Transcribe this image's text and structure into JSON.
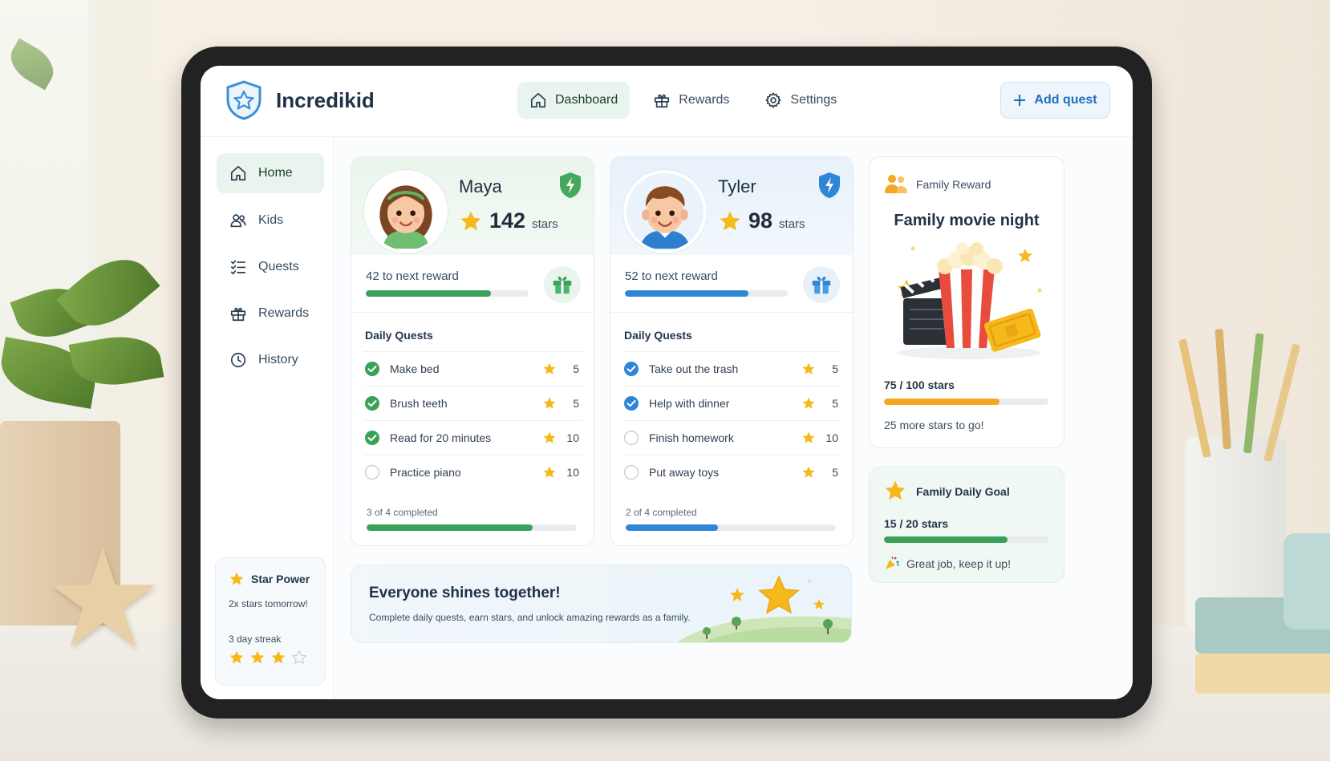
{
  "app": {
    "name": "Incredikid",
    "header_nav": [
      {
        "label": "Dashboard",
        "icon": "home-icon",
        "active": true
      },
      {
        "label": "Rewards",
        "icon": "gift-icon",
        "active": false
      },
      {
        "label": "Settings",
        "icon": "gear-icon",
        "active": false
      }
    ],
    "add_quest_label": "Add quest"
  },
  "sidebar": {
    "items": [
      {
        "label": "Home",
        "icon": "home-icon",
        "active": true
      },
      {
        "label": "Kids",
        "icon": "users-icon",
        "active": false
      },
      {
        "label": "Quests",
        "icon": "checklist-icon",
        "active": false
      },
      {
        "label": "Rewards",
        "icon": "gift-icon",
        "active": false
      },
      {
        "label": "History",
        "icon": "clock-icon",
        "active": false
      }
    ],
    "star_power": {
      "title": "Star Power",
      "subtitle": "2x stars tomorrow!",
      "streak_label": "3 day streak",
      "streak_filled": 3,
      "streak_total": 4
    }
  },
  "kids": [
    {
      "name": "Maya",
      "stars": "142",
      "stars_label": "stars",
      "next_reward": "42 to next reward",
      "reward_progress": 0.77,
      "accent": "#3aa15a",
      "daily_quests_title": "Daily Quests",
      "quests": [
        {
          "name": "Make bed",
          "stars": "5",
          "done": true
        },
        {
          "name": "Brush teeth",
          "stars": "5",
          "done": true
        },
        {
          "name": "Read for 20 minutes",
          "stars": "10",
          "done": true
        },
        {
          "name": "Practice piano",
          "stars": "10",
          "done": false
        }
      ],
      "completed_label": "3 of 4 completed",
      "completed_progress": 0.79
    },
    {
      "name": "Tyler",
      "stars": "98",
      "stars_label": "stars",
      "next_reward": "52 to next reward",
      "reward_progress": 0.76,
      "accent": "#2f86d6",
      "daily_quests_title": "Daily Quests",
      "quests": [
        {
          "name": "Take out the trash",
          "stars": "5",
          "done": true
        },
        {
          "name": "Help with dinner",
          "stars": "5",
          "done": true
        },
        {
          "name": "Finish homework",
          "stars": "10",
          "done": false
        },
        {
          "name": "Put away toys",
          "stars": "5",
          "done": false
        }
      ],
      "completed_label": "2 of 4 completed",
      "completed_progress": 0.44
    }
  ],
  "family_reward": {
    "label": "Family Reward",
    "title": "Family movie night",
    "progress_label": "75 / 100 stars",
    "progress": 0.7,
    "more_label": "25 more stars to go!"
  },
  "family_goal": {
    "title": "Family Daily Goal",
    "value_label": "15 / 20 stars",
    "progress": 0.75,
    "message": "Great job, keep it up!"
  },
  "banner": {
    "title": "Everyone shines together!",
    "subtitle": "Complete daily quests, earn stars, and unlock amazing rewards as a family."
  },
  "colors": {
    "green": "#3aa15a",
    "blue": "#2f86d6",
    "gold": "#f6b91c",
    "orange": "#f5a623"
  }
}
